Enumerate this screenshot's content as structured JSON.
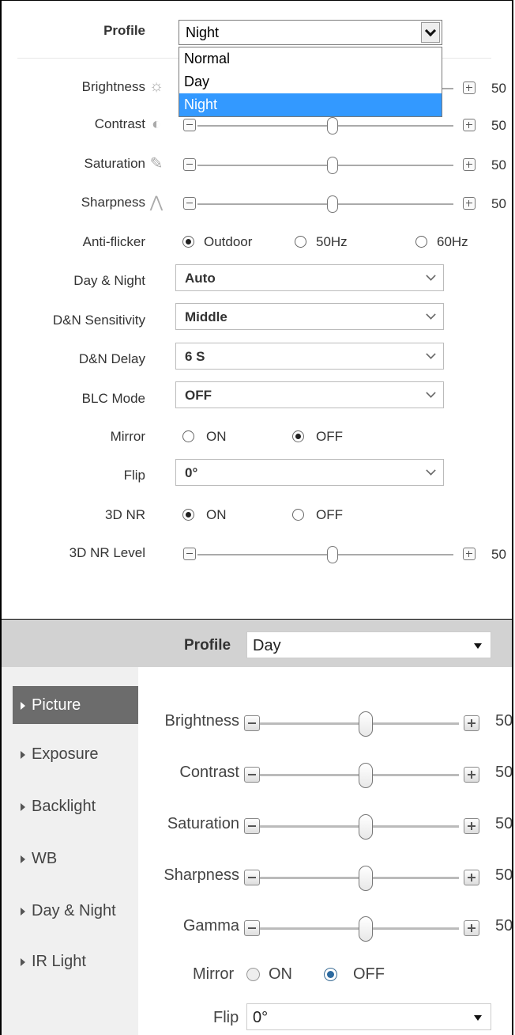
{
  "top": {
    "profile": {
      "label": "Profile",
      "selected": "Night",
      "options": [
        "Normal",
        "Day",
        "Night"
      ],
      "highlighted": "Night"
    },
    "sliders": [
      {
        "label": "Brightness",
        "value": "50",
        "icon": "sun-icon"
      },
      {
        "label": "Contrast",
        "value": "50",
        "icon": "contrast-icon"
      },
      {
        "label": "Saturation",
        "value": "50",
        "icon": "saturation-icon"
      },
      {
        "label": "Sharpness",
        "value": "50",
        "icon": "sharpness-icon"
      }
    ],
    "anti_flicker": {
      "label": "Anti-flicker",
      "options": [
        "Outdoor",
        "50Hz",
        "60Hz"
      ],
      "selected": "Outdoor"
    },
    "day_night": {
      "label": "Day & Night",
      "value": "Auto"
    },
    "dn_sensitivity": {
      "label": "D&N Sensitivity",
      "value": "Middle"
    },
    "dn_delay": {
      "label": "D&N Delay",
      "value": "6 S"
    },
    "blc_mode": {
      "label": "BLC Mode",
      "value": "OFF"
    },
    "mirror": {
      "label": "Mirror",
      "options": [
        "ON",
        "OFF"
      ],
      "selected": "OFF"
    },
    "flip": {
      "label": "Flip",
      "value": "0°"
    },
    "nr3d": {
      "label": "3D NR",
      "options": [
        "ON",
        "OFF"
      ],
      "selected": "ON"
    },
    "nr3d_level": {
      "label": "3D NR Level",
      "value": "50"
    }
  },
  "bottom": {
    "profile": {
      "label": "Profile",
      "value": "Day"
    },
    "nav": [
      "Picture",
      "Exposure",
      "Backlight",
      "WB",
      "Day & Night",
      "IR Light"
    ],
    "active_nav": "Picture",
    "sliders": [
      {
        "label": "Brightness",
        "value": "50"
      },
      {
        "label": "Contrast",
        "value": "50"
      },
      {
        "label": "Saturation",
        "value": "50"
      },
      {
        "label": "Sharpness",
        "value": "50"
      },
      {
        "label": "Gamma",
        "value": "50"
      }
    ],
    "mirror": {
      "label": "Mirror",
      "options": [
        "ON",
        "OFF"
      ],
      "selected": "OFF"
    },
    "flip": {
      "label": "Flip",
      "value": "0°"
    }
  },
  "colors": {
    "highlight": "#3399ff",
    "nav_active": "#6c6c6c",
    "radio_selected": "#2c6aa0"
  }
}
